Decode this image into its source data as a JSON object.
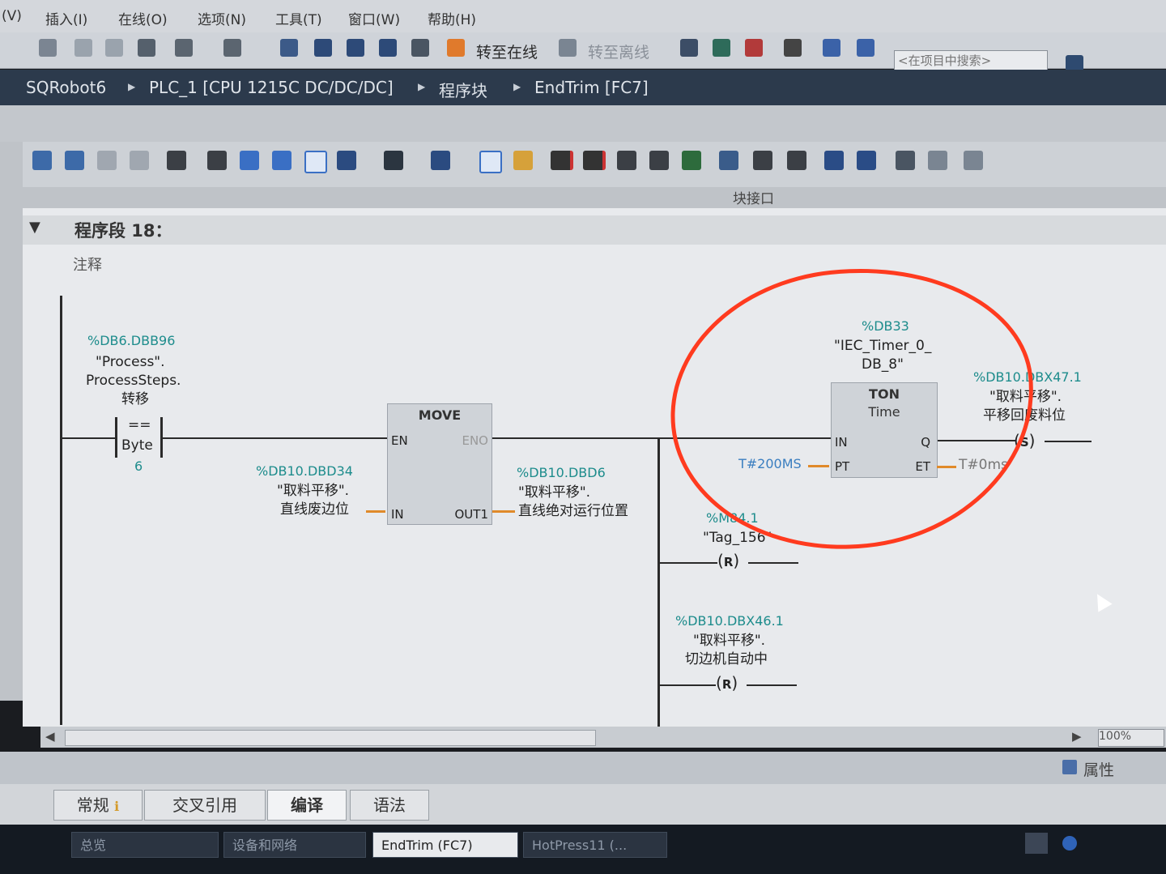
{
  "menubar": {
    "items": [
      "(V)",
      "插入(I)",
      "在线(O)",
      "选项(N)",
      "工具(T)",
      "窗口(W)",
      "帮助(H)"
    ]
  },
  "toolbar": {
    "go_online": "转至在线",
    "go_offline": "转至离线",
    "search_placeholder": "<在项目中搜索>"
  },
  "breadcrumb": {
    "items": [
      "SQRobot6",
      "PLC_1 [CPU 1215C DC/DC/DC]",
      "程序块",
      "EndTrim [FC7]"
    ]
  },
  "block_interface_label": "块接口",
  "network": {
    "title": "程序段 18：",
    "comment": "注释"
  },
  "ladder": {
    "compare": {
      "addr": "%DB6.DBB96",
      "name_line1": "\"Process\".",
      "name_line2": "ProcessSteps.",
      "name_line3": "转移",
      "op": "==",
      "type": "Byte",
      "value": "6"
    },
    "move": {
      "title": "MOVE",
      "en": "EN",
      "eno": "ENO",
      "in": "IN",
      "out": "OUT1",
      "in_addr": "%DB10.DBD34",
      "in_name1": "\"取料平移\".",
      "in_name2": "直线废边位",
      "out_addr": "%DB10.DBD6",
      "out_name1": "\"取料平移\".",
      "out_name2": "直线绝对运行位置"
    },
    "timer": {
      "db_addr": "%DB33",
      "db_name1": "\"IEC_Timer_0_",
      "db_name2": "DB_8\"",
      "type": "TON",
      "subtype": "Time",
      "in": "IN",
      "q": "Q",
      "pt": "PT",
      "et": "ET",
      "pt_value": "T#200MS",
      "et_value": "T#0ms"
    },
    "set_coil": {
      "addr": "%DB10.DBX47.1",
      "name1": "\"取料平移\".",
      "name2": "平移回废料位",
      "symbol": "S"
    },
    "reset_coil_1": {
      "addr": "%M84.1",
      "name": "\"Tag_156\"",
      "symbol": "R"
    },
    "reset_coil_2": {
      "addr": "%DB10.DBX46.1",
      "name1": "\"取料平移\".",
      "name2": "切边机自动中",
      "symbol": "R"
    }
  },
  "zoom": "100%",
  "properties_label": "属性",
  "inspector_tabs": [
    "常规",
    "交叉引用",
    "编译",
    "语法"
  ],
  "taskbar": {
    "items": [
      "总览",
      "设备和网络",
      "EndTrim (FC7)",
      "HotPress11 (..."
    ]
  },
  "colors": {
    "highlight_ring": "#ff3b1f",
    "address_text": "#1d8c8c",
    "breadcrumb_bg": "#2c3a4c"
  }
}
